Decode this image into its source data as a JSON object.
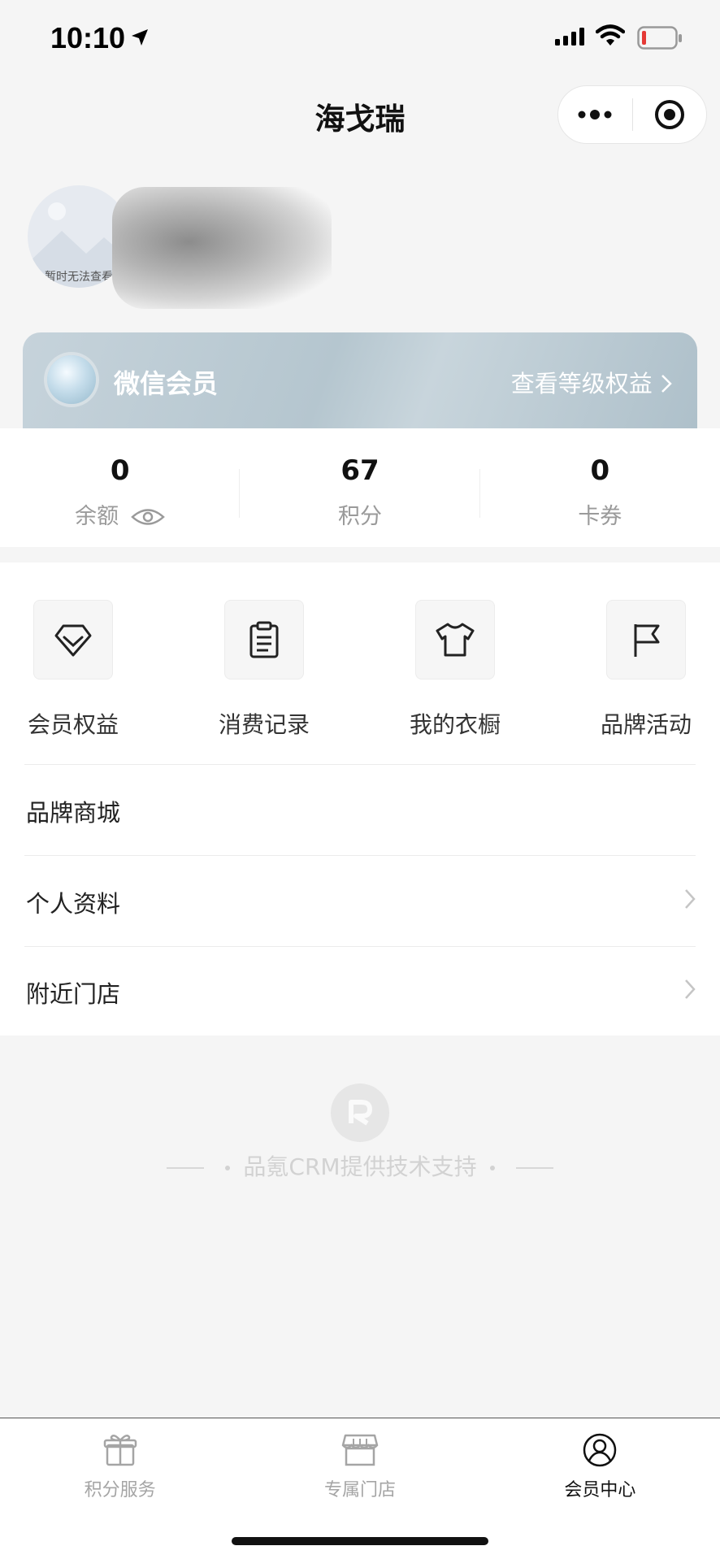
{
  "status_bar": {
    "time": "10:10"
  },
  "nav": {
    "title": "海戈瑞"
  },
  "profile": {
    "avatar_placeholder": "暂时无法查看"
  },
  "member_card": {
    "level_name": "微信会员",
    "benefits_link": "查看等级权益"
  },
  "stats": [
    {
      "value": "0",
      "label": "余额"
    },
    {
      "value": "67",
      "label": "积分"
    },
    {
      "value": "0",
      "label": "卡券"
    }
  ],
  "grid_menu": [
    {
      "label": "会员权益",
      "icon": "diamond-icon"
    },
    {
      "label": "消费记录",
      "icon": "clipboard-icon"
    },
    {
      "label": "我的衣橱",
      "icon": "tshirt-icon"
    },
    {
      "label": "品牌活动",
      "icon": "flag-icon"
    }
  ],
  "list_menu": [
    {
      "label": "品牌商城",
      "has_chevron": false
    },
    {
      "label": "个人资料",
      "has_chevron": true
    },
    {
      "label": "附近门店",
      "has_chevron": true
    }
  ],
  "footer": {
    "support_text": "品氪CRM提供技术支持"
  },
  "tabs": [
    {
      "label": "积分服务",
      "icon": "gift-icon",
      "active": false
    },
    {
      "label": "专属门店",
      "icon": "store-icon",
      "active": false
    },
    {
      "label": "会员中心",
      "icon": "user-icon",
      "active": true
    }
  ]
}
